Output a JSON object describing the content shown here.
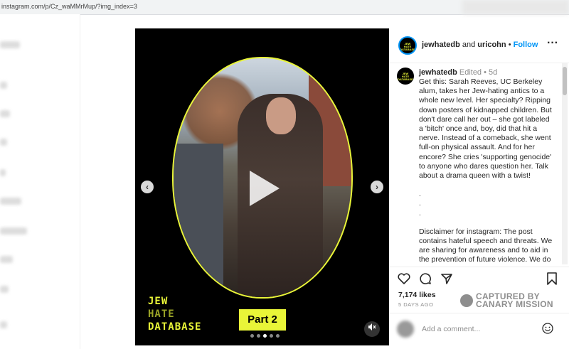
{
  "browser": {
    "url": "instagram.com/p/Cz_waMMrMup/?img_index=3"
  },
  "media": {
    "brand_line1": "JEW",
    "brand_line2": "HATE",
    "brand_line3": "DATABASE",
    "part_label": "Part 2",
    "carousel_count": 5,
    "carousel_active_index": 3,
    "prev_icon": "chevron-left-icon",
    "next_icon": "chevron-right-icon",
    "mute_icon": "speaker-muted-icon",
    "accent_color": "#e9f538"
  },
  "header": {
    "user1": "jewhatedb",
    "and": "and",
    "user2": "uricohn",
    "separator": "•",
    "follow_label": "Follow",
    "more_icon": "more-horizontal-icon"
  },
  "caption": {
    "username": "jewhatedb",
    "edited": "Edited",
    "separator": "•",
    "time": "5d",
    "paragraph1": "Get this: Sarah Reeves, UC Berkeley alum, takes her Jew-hating antics to a whole new level. Her specialty? Ripping down posters of kidnapped children. But don't dare call her out – she got labeled a 'bitch' once and, boy, did that hit a nerve. Instead of a comeback, she went full-on physical assault. And for her encore? She cries 'supporting genocide' to anyone who dares question her. Talk about a drama queen with a twist!",
    "dot": ".",
    "paragraph2": "Disclaimer for instagram: The post contains hateful speech and threats. We are sharing for awareness and to aid in the prevention of future violence. We do"
  },
  "actions": {
    "likes": "7,174 likes",
    "date": "5 DAYS AGO",
    "watermark_line1": "CAPTURED BY",
    "watermark_line2": "CANARY MISSION"
  },
  "comment": {
    "placeholder": "Add a comment...",
    "emoji_icon": "smiley-icon"
  }
}
